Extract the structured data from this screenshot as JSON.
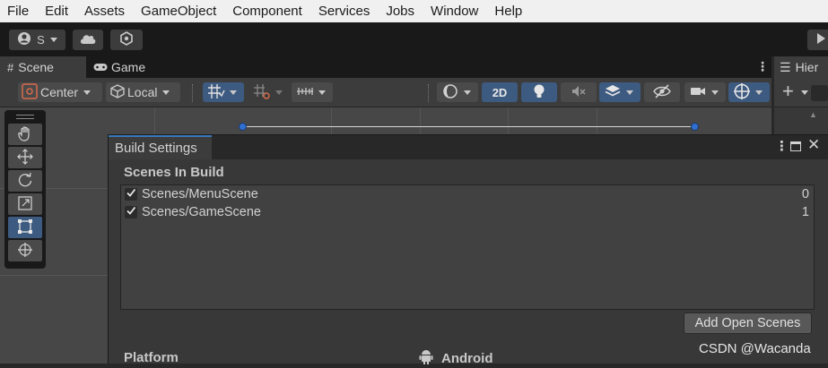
{
  "menu": [
    "File",
    "Edit",
    "Assets",
    "GameObject",
    "Component",
    "Services",
    "Jobs",
    "Window",
    "Help"
  ],
  "toolbar": {
    "account_label": "S"
  },
  "scene_tabs": {
    "scene": "Scene",
    "game": "Game",
    "hierarchy": "Hier"
  },
  "scene_toolbar": {
    "pivot": "Center",
    "space": "Local",
    "mode_2d": "2D"
  },
  "build_settings": {
    "title": "Build Settings",
    "scenes_header": "Scenes In Build",
    "scenes": [
      {
        "name": "Scenes/MenuScene",
        "index": "0",
        "checked": true
      },
      {
        "name": "Scenes/GameScene",
        "index": "1",
        "checked": true
      }
    ],
    "add_open_scenes": "Add Open Scenes",
    "platform_header": "Platform",
    "platform_selected": "Android"
  },
  "watermark": "CSDN @Wacanda",
  "colors": {
    "accent_blue": "#3d5a80",
    "tab_accent": "#3a79bb",
    "handle_blue": "#2f6fcf"
  }
}
